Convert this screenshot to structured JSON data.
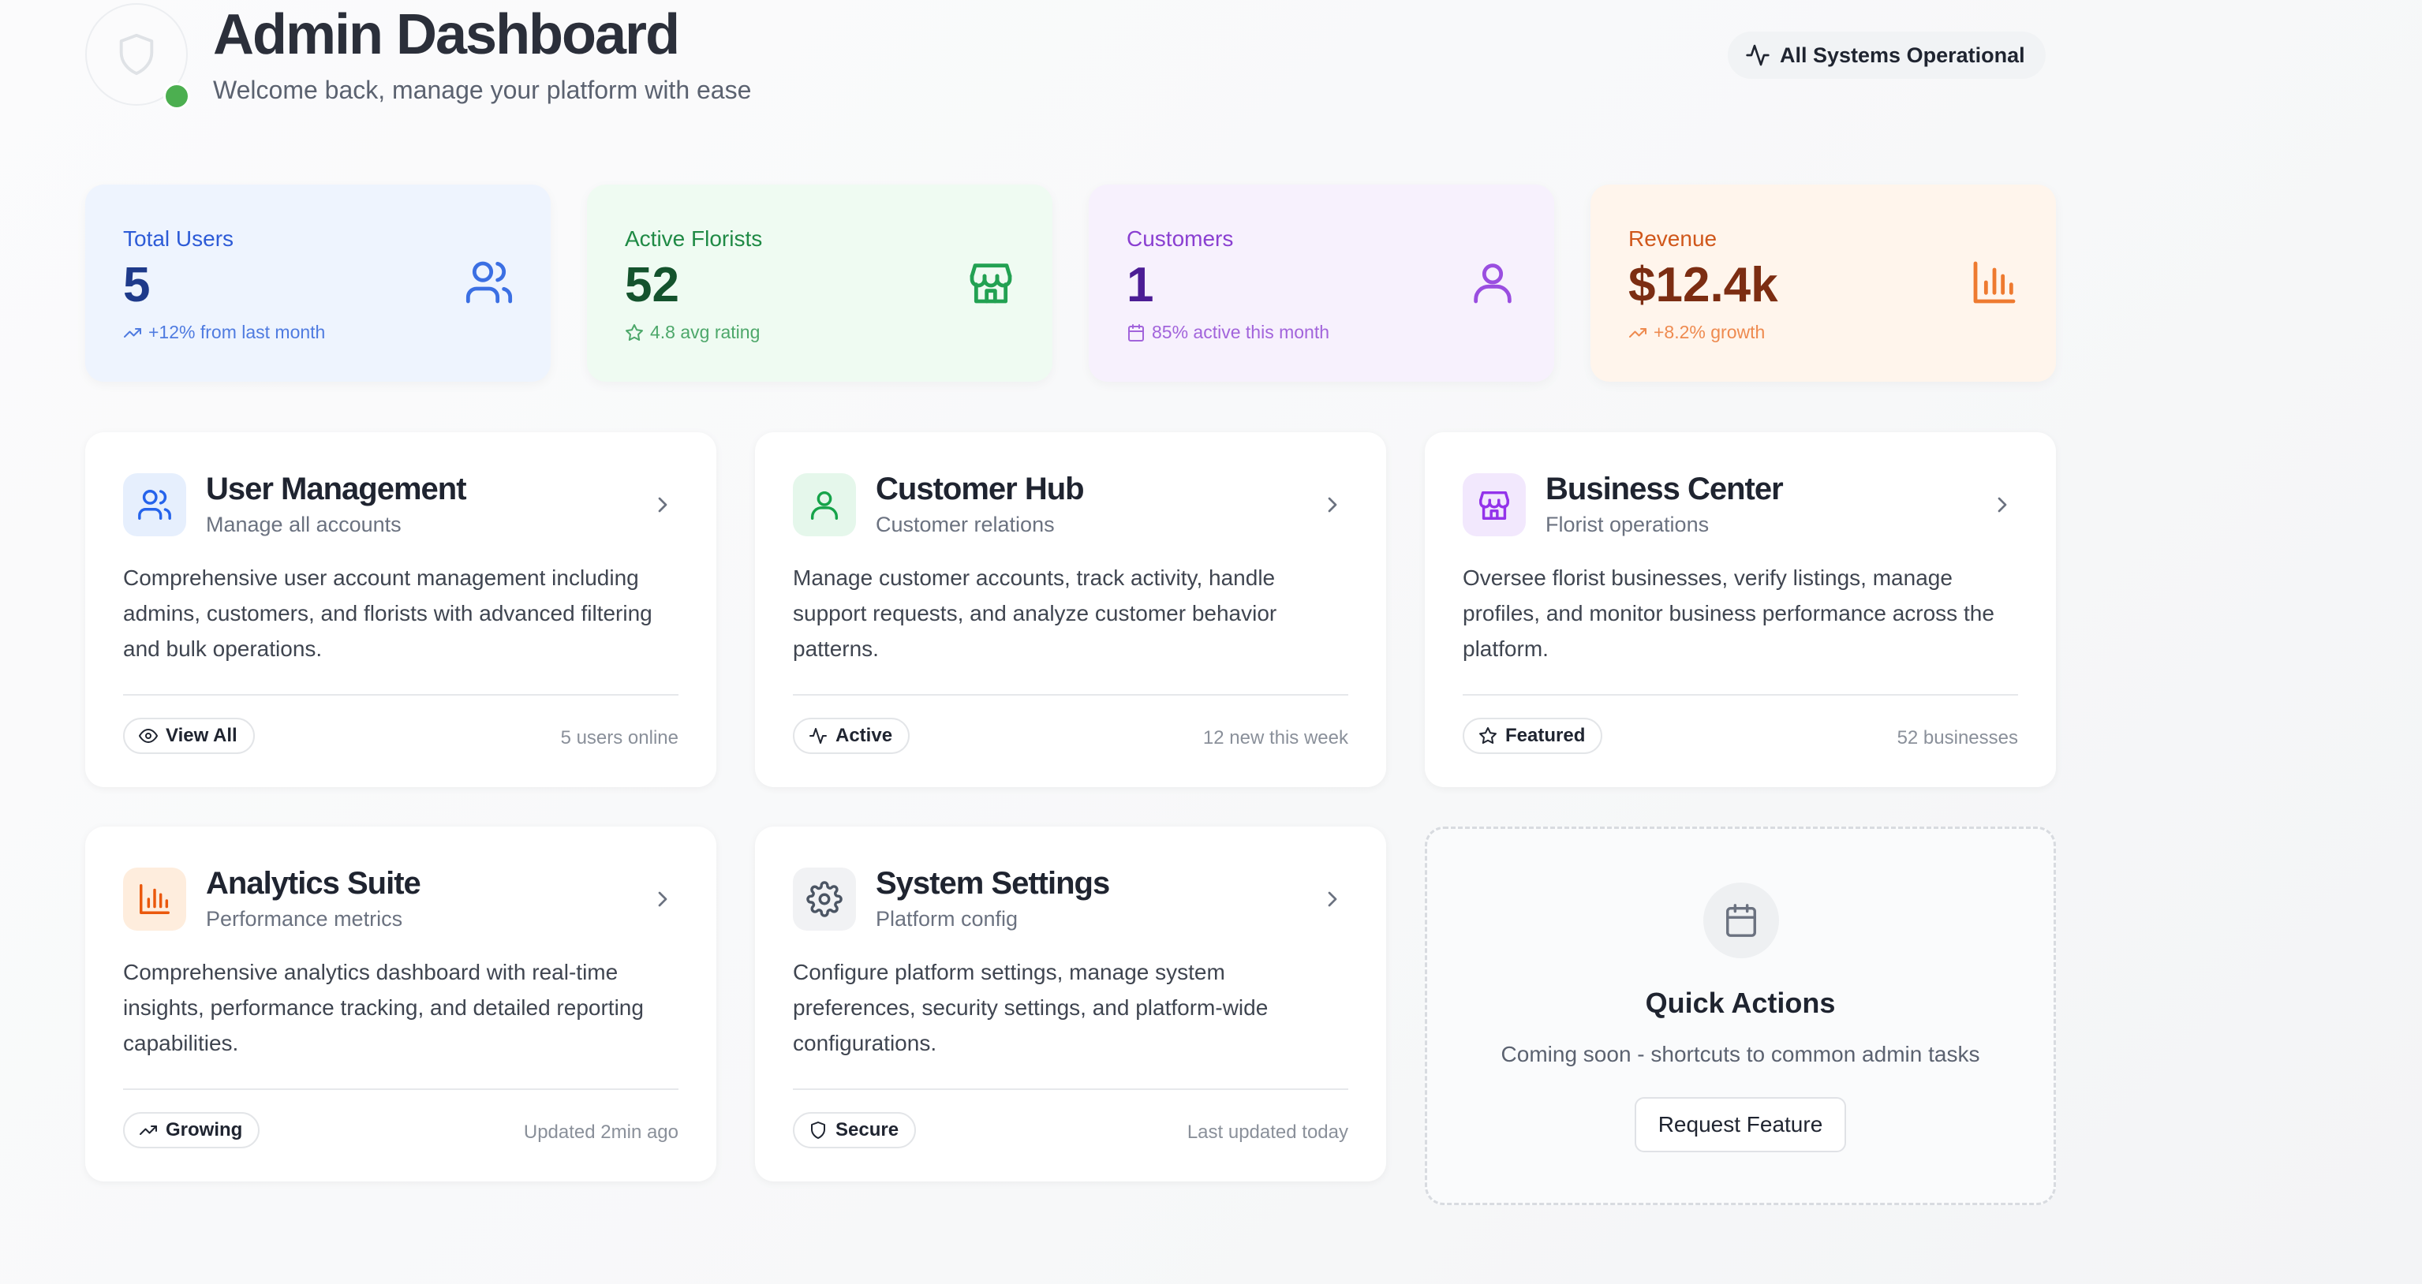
{
  "header": {
    "title": "Admin Dashboard",
    "subtitle": "Welcome back, manage your platform with ease",
    "status_badge": "All Systems Operational"
  },
  "stats": [
    {
      "label": "Total Users",
      "value": "5",
      "footnote": "+12% from last month",
      "icon": "users-icon",
      "foot_icon": "trending-up-icon",
      "color": "#1d4ed8"
    },
    {
      "label": "Active Florists",
      "value": "52",
      "footnote": "4.8 avg rating",
      "icon": "store-icon",
      "foot_icon": "star-icon",
      "color": "#16a34a"
    },
    {
      "label": "Customers",
      "value": "1",
      "footnote": "85% active this month",
      "icon": "user-icon",
      "foot_icon": "calendar-icon",
      "color": "#9333ea"
    },
    {
      "label": "Revenue",
      "value": "$12.4k",
      "footnote": "+8.2% growth",
      "icon": "bar-chart-icon",
      "foot_icon": "trending-up-icon",
      "color": "#ea580c"
    }
  ],
  "cards": [
    {
      "title": "User Management",
      "subtitle": "Manage all accounts",
      "description": "Comprehensive user account management including admins, customers, and florists with advanced filtering and bulk operations.",
      "pill": "View All",
      "pill_icon": "eye-icon",
      "meta": "5 users online",
      "icon": "users-icon",
      "accent": "#2563eb"
    },
    {
      "title": "Customer Hub",
      "subtitle": "Customer relations",
      "description": "Manage customer accounts, track activity, handle support requests, and analyze customer behavior patterns.",
      "pill": "Active",
      "pill_icon": "activity-icon",
      "meta": "12 new this week",
      "icon": "user-icon",
      "accent": "#16a34a"
    },
    {
      "title": "Business Center",
      "subtitle": "Florist operations",
      "description": "Oversee florist businesses, verify listings, manage profiles, and monitor business performance across the platform.",
      "pill": "Featured",
      "pill_icon": "star-icon",
      "meta": "52 businesses",
      "icon": "store-icon",
      "accent": "#9333ea"
    },
    {
      "title": "Analytics Suite",
      "subtitle": "Performance metrics",
      "description": "Comprehensive analytics dashboard with real-time insights, performance tracking, and detailed reporting capabilities.",
      "pill": "Growing",
      "pill_icon": "trending-up-icon",
      "meta": "Updated 2min ago",
      "icon": "bar-chart-icon",
      "accent": "#ea580c"
    },
    {
      "title": "System Settings",
      "subtitle": "Platform config",
      "description": "Configure platform settings, manage system preferences, security settings, and platform-wide configurations.",
      "pill": "Secure",
      "pill_icon": "shield-icon",
      "meta": "Last updated today",
      "icon": "gear-icon",
      "accent": "#4b5563"
    }
  ],
  "quick_actions": {
    "title": "Quick Actions",
    "subtitle": "Coming soon - shortcuts to common admin tasks",
    "button": "Request Feature",
    "icon": "calendar-icon"
  }
}
